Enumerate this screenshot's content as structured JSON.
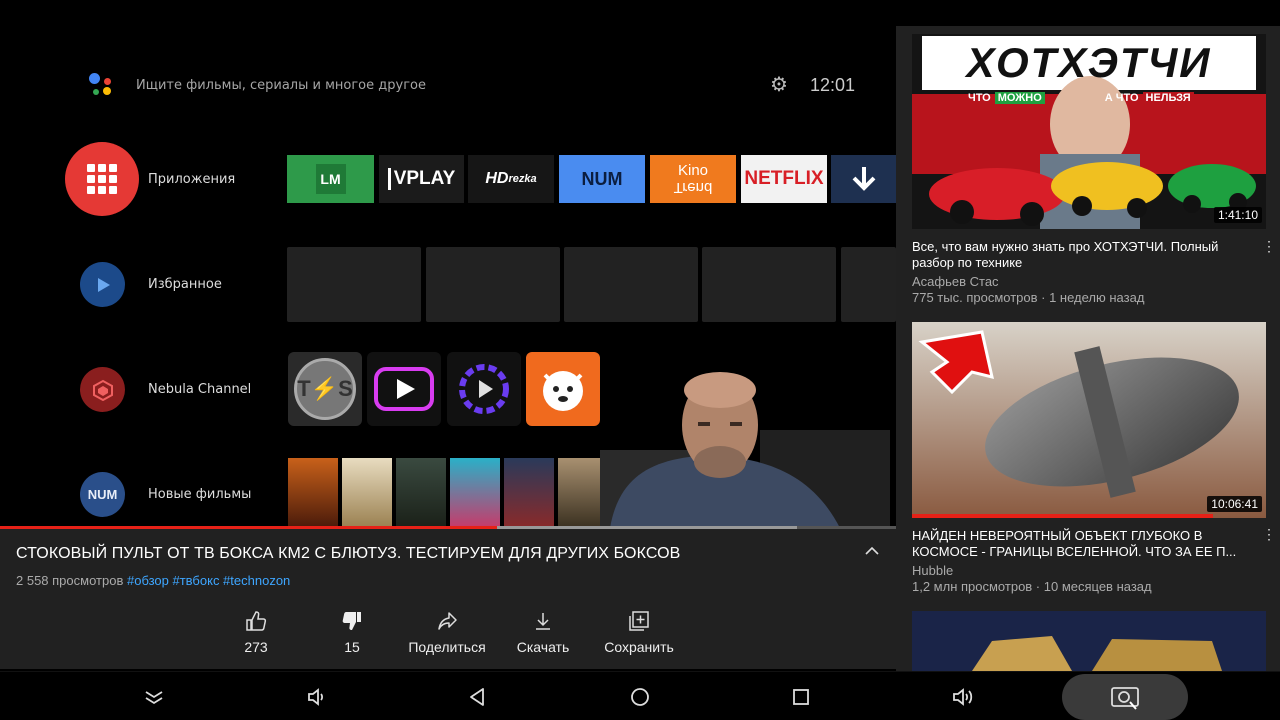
{
  "tv": {
    "search_placeholder": "Ищите фильмы, сериалы и многое другое",
    "clock": "12:01",
    "rows": [
      {
        "label": "Приложения"
      },
      {
        "label": "Избранное"
      },
      {
        "label": "Nebula Channel"
      },
      {
        "label": "Новые фильмы"
      }
    ],
    "new_movies_icon_text": "NUM",
    "apps": [
      {
        "name": "LM",
        "color": "#2e9a4a"
      },
      {
        "name": "VPLAY",
        "color": "#1b1b1b"
      },
      {
        "name": "HDrezka",
        "color": "#1b1b1b"
      },
      {
        "name": "NUM",
        "color": "#4a8cf0"
      },
      {
        "name": "Kino Trend",
        "color": "#f07a1e"
      },
      {
        "name": "NETFLIX",
        "color": "#f2f2f2"
      },
      {
        "name": "download",
        "color": "#1e3050"
      }
    ]
  },
  "video": {
    "title": "СТОКОВЫЙ ПУЛЬТ ОТ ТВ БОКСА КМ2 С БЛЮТУЗ. ТЕСТИРУЕМ ДЛЯ ДРУГИХ БОКСОВ",
    "views": "2 558 просмотров",
    "hashtags": "#обзор #твбокс #technozon",
    "progress_fraction": 0.555,
    "buffered_fraction": 0.89
  },
  "actions": {
    "like_count": "273",
    "dislike_count": "15",
    "share_label": "Поделиться",
    "download_label": "Скачать",
    "save_label": "Сохранить"
  },
  "recommendations": [
    {
      "thumb_text": "ХОТХЭТЧИ",
      "thumb_banner_1": "ЧТО",
      "thumb_banner_2": "МОЖНО",
      "thumb_banner_3": "А ЧТО",
      "thumb_banner_4": "НЕЛЬЗЯ",
      "duration": "1:41:10",
      "title": "Все, что вам нужно знать про ХОТХЭТЧИ. Полный разбор по технике",
      "channel": "Асафьев Стас",
      "meta": "775 тыс. просмотров · 1 неделю назад",
      "watched_fraction": 0
    },
    {
      "duration": "10:06:41",
      "title": "НАЙДЕН НЕВЕРОЯТНЫЙ ОБЪЕКТ ГЛУБОКО В КОСМОСЕ - ГРАНИЦЫ ВСЕЛЕННОЙ. ЧТО ЗА ЕЕ П...",
      "channel": "Hubble",
      "meta": "1,2 млн просмотров · 10 месяцев назад",
      "watched_fraction": 0.85
    }
  ],
  "navbar": {
    "buttons": [
      "collapse-icon",
      "volume-down-icon",
      "back-icon",
      "home-icon",
      "recents-icon",
      "volume-up-icon",
      "screenshot-icon"
    ]
  }
}
